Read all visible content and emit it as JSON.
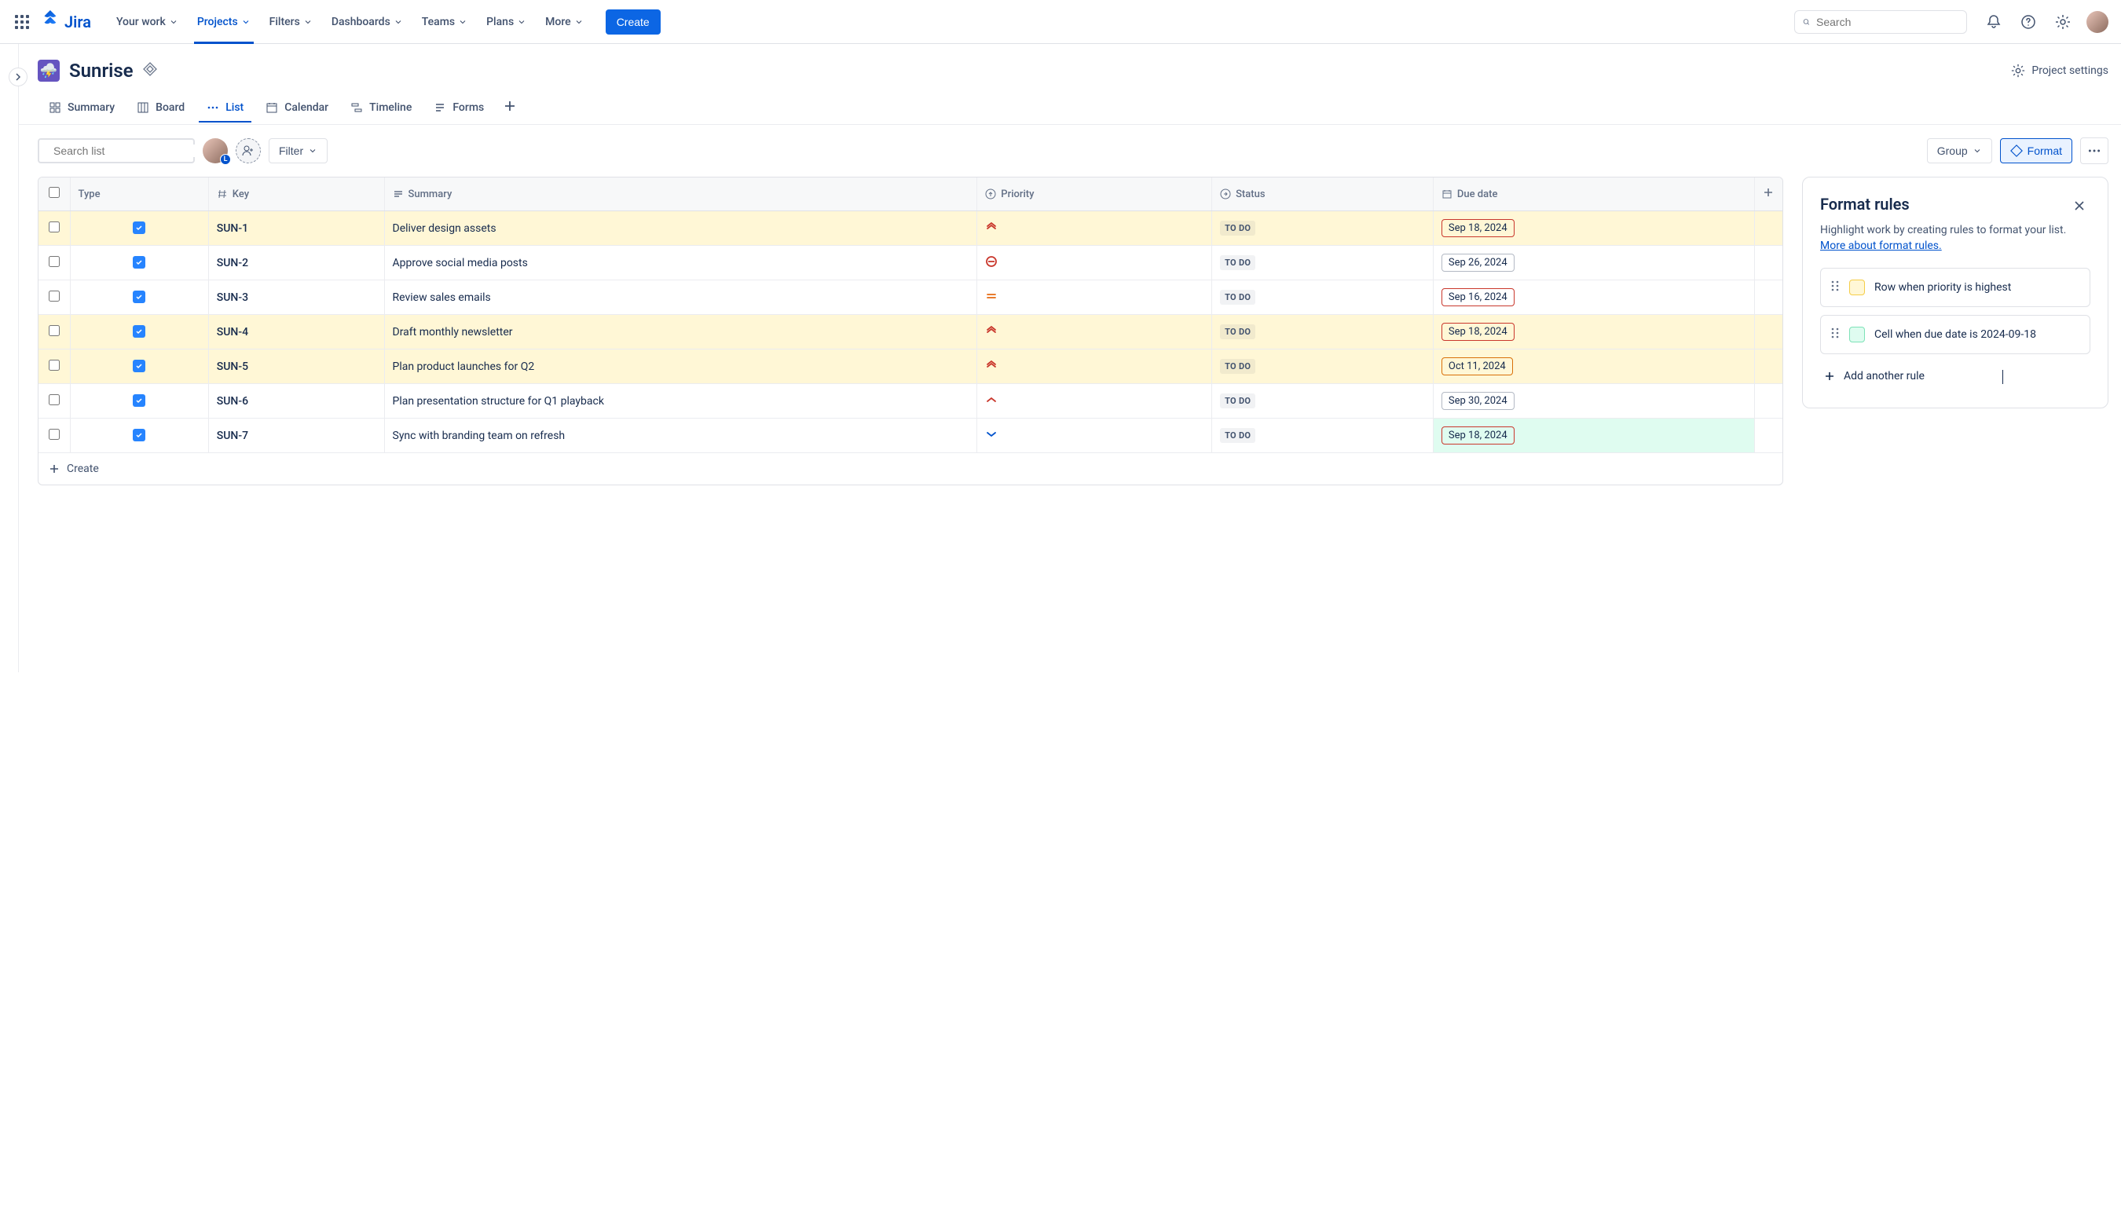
{
  "app": {
    "name": "Jira"
  },
  "nav": {
    "items": [
      {
        "label": "Your work"
      },
      {
        "label": "Projects"
      },
      {
        "label": "Filters"
      },
      {
        "label": "Dashboards"
      },
      {
        "label": "Teams"
      },
      {
        "label": "Plans"
      },
      {
        "label": "More"
      }
    ],
    "create": "Create",
    "search_placeholder": "Search"
  },
  "project": {
    "title": "Sunrise",
    "settings_label": "Project settings",
    "icon_emoji": "⛈️"
  },
  "tabs": [
    {
      "label": "Summary",
      "icon": "grid"
    },
    {
      "label": "Board",
      "icon": "board"
    },
    {
      "label": "List",
      "icon": "dots"
    },
    {
      "label": "Calendar",
      "icon": "calendar"
    },
    {
      "label": "Timeline",
      "icon": "timeline"
    },
    {
      "label": "Forms",
      "icon": "forms"
    }
  ],
  "toolbar": {
    "search_placeholder": "Search list",
    "filter": "Filter",
    "group": "Group",
    "format": "Format"
  },
  "columns": {
    "type": "Type",
    "key": "Key",
    "summary": "Summary",
    "priority": "Priority",
    "status": "Status",
    "due": "Due date"
  },
  "rows": [
    {
      "key": "SUN-1",
      "summary": "Deliver design assets",
      "priority": "highest",
      "status": "TO DO",
      "due": "Sep 18, 2024",
      "row_hl": "yellow",
      "date_style": "yellow-red"
    },
    {
      "key": "SUN-2",
      "summary": "Approve social media posts",
      "priority": "blocker",
      "status": "TO DO",
      "due": "Sep 26, 2024",
      "row_hl": "",
      "date_style": ""
    },
    {
      "key": "SUN-3",
      "summary": "Review sales emails",
      "priority": "medium",
      "status": "TO DO",
      "due": "Sep 16, 2024",
      "row_hl": "",
      "date_style": "red"
    },
    {
      "key": "SUN-4",
      "summary": "Draft monthly newsletter",
      "priority": "highest",
      "status": "TO DO",
      "due": "Sep 18, 2024",
      "row_hl": "yellow",
      "date_style": "yellow-red"
    },
    {
      "key": "SUN-5",
      "summary": "Plan product launches for Q2",
      "priority": "highest",
      "status": "TO DO",
      "due": "Oct 11, 2024",
      "row_hl": "yellow",
      "date_style": "yellow"
    },
    {
      "key": "SUN-6",
      "summary": "Plan presentation structure for Q1 playback",
      "priority": "high",
      "status": "TO DO",
      "due": "Sep 30, 2024",
      "row_hl": "",
      "date_style": ""
    },
    {
      "key": "SUN-7",
      "summary": "Sync with branding team on refresh",
      "priority": "low",
      "status": "TO DO",
      "due": "Sep 18, 2024",
      "row_hl": "",
      "date_style": "green-red"
    }
  ],
  "create_row": "Create",
  "panel": {
    "title": "Format rules",
    "desc": "Highlight work by creating rules to format your list. ",
    "link": "More about format rules.",
    "rules": [
      {
        "swatch": "yellow",
        "label": "Row when priority is highest"
      },
      {
        "swatch": "green",
        "label": "Cell when due date is 2024-09-18"
      }
    ],
    "add": "Add another rule"
  }
}
